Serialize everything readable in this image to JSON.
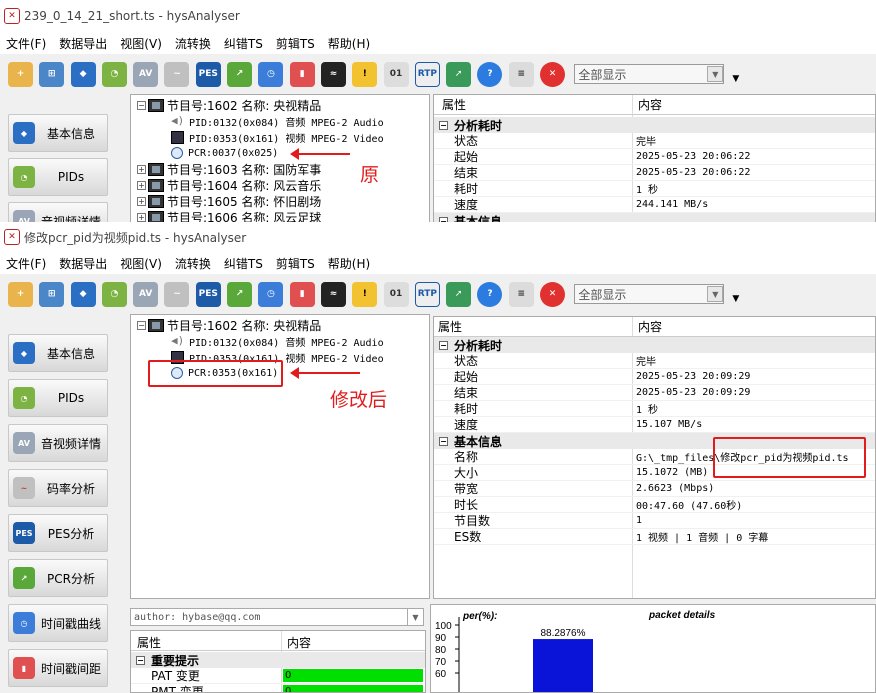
{
  "win1": {
    "title": "239_0_14_21_short.ts - hysAnalyser",
    "menu": [
      "文件(F)",
      "数据导出",
      "视图(V)",
      "流转换",
      "纠错TS",
      "剪辑TS",
      "帮助(H)"
    ],
    "filter": "全部显示",
    "nav": [
      "基本信息",
      "PIDs",
      "音视频详情"
    ],
    "tree": {
      "program": "节目号:1602 名称: 央视精品",
      "audio": "PID:0132(0x084) 音频 MPEG-2 Audio",
      "video": "PID:0353(0x161) 视频 MPEG-2 Video",
      "pcr": "PCR:0037(0x025)",
      "others": [
        "节目号:1603 名称: 国防军事",
        "节目号:1604 名称: 风云音乐",
        "节目号:1605 名称: 怀旧剧场",
        "节目号:1606 名称: 风云足球"
      ]
    },
    "annotation": "原",
    "props": {
      "col_key": "属性",
      "col_val": "内容",
      "sec1": "分析耗时",
      "rows": [
        [
          "状态",
          "完毕"
        ],
        [
          "起始",
          "2025-05-23 20:06:22"
        ],
        [
          "结束",
          "2025-05-23 20:06:22"
        ],
        [
          "耗时",
          "1 秒"
        ],
        [
          "速度",
          "244.141 MB/s"
        ]
      ],
      "sec2": "基本信息"
    }
  },
  "win2": {
    "title": "修改pcr_pid为视频pid.ts - hysAnalyser",
    "menu": [
      "文件(F)",
      "数据导出",
      "视图(V)",
      "流转换",
      "纠错TS",
      "剪辑TS",
      "帮助(H)"
    ],
    "filter": "全部显示",
    "nav": [
      "基本信息",
      "PIDs",
      "音视频详情",
      "码率分析",
      "PES分析",
      "PCR分析",
      "时间戳曲线",
      "时间戳间距"
    ],
    "tree": {
      "program": "节目号:1602 名称: 央视精品",
      "audio": "PID:0132(0x084) 音频 MPEG-2 Audio",
      "video": "PID:0353(0x161) 视频 MPEG-2 Video",
      "pcr": "PCR:0353(0x161)"
    },
    "annotation": "修改后",
    "props": {
      "col_key": "属性",
      "col_val": "内容",
      "sec1": "分析耗时",
      "rows1": [
        [
          "状态",
          "完毕"
        ],
        [
          "起始",
          "2025-05-23 20:09:29"
        ],
        [
          "结束",
          "2025-05-23 20:09:29"
        ],
        [
          "耗时",
          "1 秒"
        ],
        [
          "速度",
          "15.107 MB/s"
        ]
      ],
      "sec2": "基本信息",
      "rows2": [
        [
          "名称",
          "G:\\_tmp_files\\修改pcr_pid为视频pid.ts"
        ],
        [
          "大小",
          "15.1072 (MB)"
        ],
        [
          "带宽",
          "2.6623 (Mbps)"
        ],
        [
          "时长",
          "00:47.60 (47.60秒)"
        ],
        [
          "节目数",
          "1"
        ],
        [
          "ES数",
          "1 视频 | 1 音频 | 0 字幕"
        ]
      ]
    },
    "author": "author: hybase@qq.com",
    "alerts": {
      "col_key": "属性",
      "col_val": "内容",
      "sec": "重要提示",
      "rows": [
        [
          "PAT 变更",
          "0"
        ],
        [
          "PMT 变更",
          "0"
        ]
      ]
    },
    "chart": {
      "ylabel": "per(%):",
      "title": "packet details",
      "label": "88.2876%",
      "value": 88.2876,
      "ticks": [
        "100",
        "90",
        "80",
        "70",
        "60"
      ]
    }
  },
  "colors": {
    "accent_red": "#e21c1c",
    "bar_blue": "#0a14d8",
    "alert_green": "#00e000"
  }
}
